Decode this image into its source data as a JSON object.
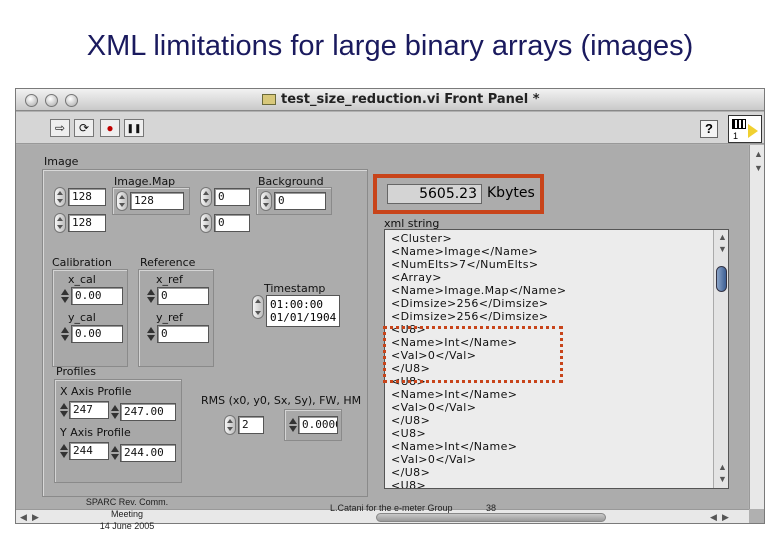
{
  "slide": {
    "title": "XML limitations for large binary arrays (images)",
    "footer_left_lines": [
      "SPARC Rev. Comm.",
      "Meeting",
      "14 June 2005"
    ],
    "footer_center": "L.Catani for the e-meter Group",
    "footer_page": "38"
  },
  "window": {
    "title": "test_size_reduction.vi Front Panel *",
    "toolbar": {
      "run": "⇨",
      "run_continuous": "⟳",
      "abort": "●",
      "pause": "❚❚",
      "help": "?",
      "connector_number": "1"
    }
  },
  "image_cluster": {
    "label": "Image",
    "image_map_label": "Image.Map",
    "background_label": "Background",
    "outer_values": [
      "128",
      "128"
    ],
    "image_map_value": "128",
    "background_outer": [
      "0",
      "0"
    ],
    "background_value": "0"
  },
  "calibration": {
    "label": "Calibration",
    "x_cal_label": "x_cal",
    "x_cal_value": "0.00",
    "y_cal_label": "y_cal",
    "y_cal_value": "0.00"
  },
  "reference": {
    "label": "Reference",
    "x_ref_label": "x_ref",
    "x_ref_value": "0",
    "y_ref_label": "y_ref",
    "y_ref_value": "0"
  },
  "timestamp": {
    "label": "Timestamp",
    "time": "01:00:00",
    "date": "01/01/1904"
  },
  "profiles": {
    "label": "Profiles",
    "x_label": "X Axis Profile",
    "x_index": "247",
    "x_value": "247.00",
    "y_label": "Y Axis Profile",
    "y_index": "244",
    "y_value": "244.00"
  },
  "rms": {
    "label": "RMS (x0, y0, Sx, Sy), FW, HM",
    "index": "2",
    "value": "0.0000"
  },
  "size_indicator": {
    "value": "5605.23",
    "unit": "Kbytes"
  },
  "xml_string": {
    "label": "xml string",
    "lines": [
      "<Cluster>",
      "<Name>Image</Name>",
      "<NumElts>7</NumElts>",
      "<Array>",
      "<Name>Image.Map</Name>",
      "<Dimsize>256</Dimsize>",
      "<Dimsize>256</Dimsize>",
      "<U8>",
      "<Name>Int</Name>",
      "<Val>0</Val>",
      "</U8>",
      "<U8>",
      "<Name>Int</Name>",
      "<Val>0</Val>",
      "</U8>",
      "<U8>",
      "<Name>Int</Name>",
      "<Val>0</Val>",
      "</U8>",
      "<U8>"
    ]
  },
  "colors": {
    "highlight": "#c8441a",
    "panel": "#acacac",
    "title_text": "#1a1a5e"
  }
}
